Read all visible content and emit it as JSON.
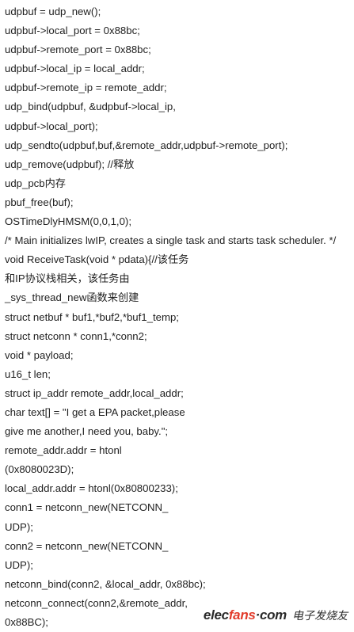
{
  "code_lines": [
    "udpbuf = udp_new();",
    "udpbuf->local_port = 0x88bc;",
    "udpbuf->remote_port = 0x88bc;",
    "udpbuf->local_ip = local_addr;",
    "udpbuf->remote_ip = remote_addr;",
    "udp_bind(udpbuf, &udpbuf->local_ip,",
    "udpbuf->local_port);",
    "udp_sendto(udpbuf,buf,&remote_addr,udpbuf->remote_port);",
    "udp_remove(udpbuf); //释放",
    "udp_pcb内存",
    "pbuf_free(buf);",
    "OSTimeDlyHMSM(0,0,1,0);",
    "/* Main initializes lwIP, creates a single task and starts task scheduler. */",
    "void ReceiveTask(void * pdata){//该任务",
    "和IP协议栈相关，该任务由",
    "_sys_thread_new函数来创建",
    "struct netbuf * buf1,*buf2,*buf1_temp;",
    "struct netconn * conn1,*conn2;",
    "void * payload;",
    "u16_t len;",
    "struct ip_addr remote_addr,local_addr;",
    "char text[] = \"I get a EPA packet,please",
    "give me another,I need you, baby.\";",
    "remote_addr.addr = htonl",
    "(0x8080023D);",
    "local_addr.addr = htonl(0x80800233);",
    "conn1 = netconn_new(NETCONN_",
    "UDP);",
    "conn2 = netconn_new(NETCONN_",
    "UDP);",
    "netconn_bind(conn2, &local_addr, 0x88bc);",
    "netconn_connect(conn2,&remote_addr,",
    "0x88BC);"
  ],
  "watermark": {
    "logo_part1": "elec",
    "logo_dot": "fans",
    "logo_part2": "·com",
    "chinese": "电子发烧友",
    "accent_color": "#e23b2a"
  }
}
